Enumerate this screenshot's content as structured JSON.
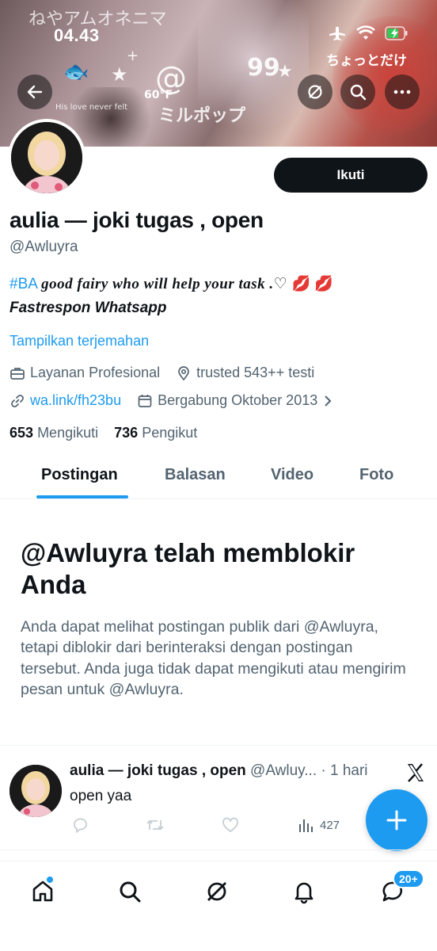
{
  "status_bar": {
    "time": "04.43"
  },
  "banner": {
    "jp_text_1": "ねやアムオネニマ",
    "jp_text_2": "ちょっとだけ",
    "jp_text_3": "ミルポップ",
    "small_text": "His love never felt",
    "temp_text": "60°F"
  },
  "profile": {
    "follow_label": "Ikuti",
    "name": "aulia — joki tugas , open",
    "handle": "@Awluyra",
    "bio_tag": "#BA",
    "bio_text": "good fairy who will help your task .♡",
    "bio_emoji": "💋 💋",
    "bio_line2": "Fastrespon Whatsapp",
    "translate_label": "Tampilkan terjemahan",
    "category": "Layanan Profesional",
    "location": "trusted 543++ testi",
    "website": "wa.link/fh23bu",
    "joined": "Bergabung Oktober 2013",
    "following_count": "653",
    "following_label": "Mengikuti",
    "followers_count": "736",
    "followers_label": "Pengikut"
  },
  "tabs": [
    {
      "label": "Postingan",
      "active": true
    },
    {
      "label": "Balasan",
      "active": false
    },
    {
      "label": "Video",
      "active": false
    },
    {
      "label": "Foto",
      "active": false
    }
  ],
  "blocked": {
    "title": "@Awluyra telah memblokir Anda",
    "body": "Anda dapat melihat postingan publik dari @Awluyra, tetapi diblokir dari berinteraksi dengan postingan tersebut. Anda juga tidak dapat mengikuti atau mengirim pesan untuk @Awluyra."
  },
  "post": {
    "author_name": "aulia — joki tugas , open",
    "author_handle": "@Awluy...",
    "time": "· 1 hari",
    "text": "open yaa",
    "views": "427",
    "source_icon": "x-logo-icon"
  },
  "bottom_nav": {
    "messages_badge": "20+"
  },
  "colors": {
    "accent": "#1d9bf0",
    "text_primary": "#0f1419",
    "text_secondary": "#536471"
  }
}
